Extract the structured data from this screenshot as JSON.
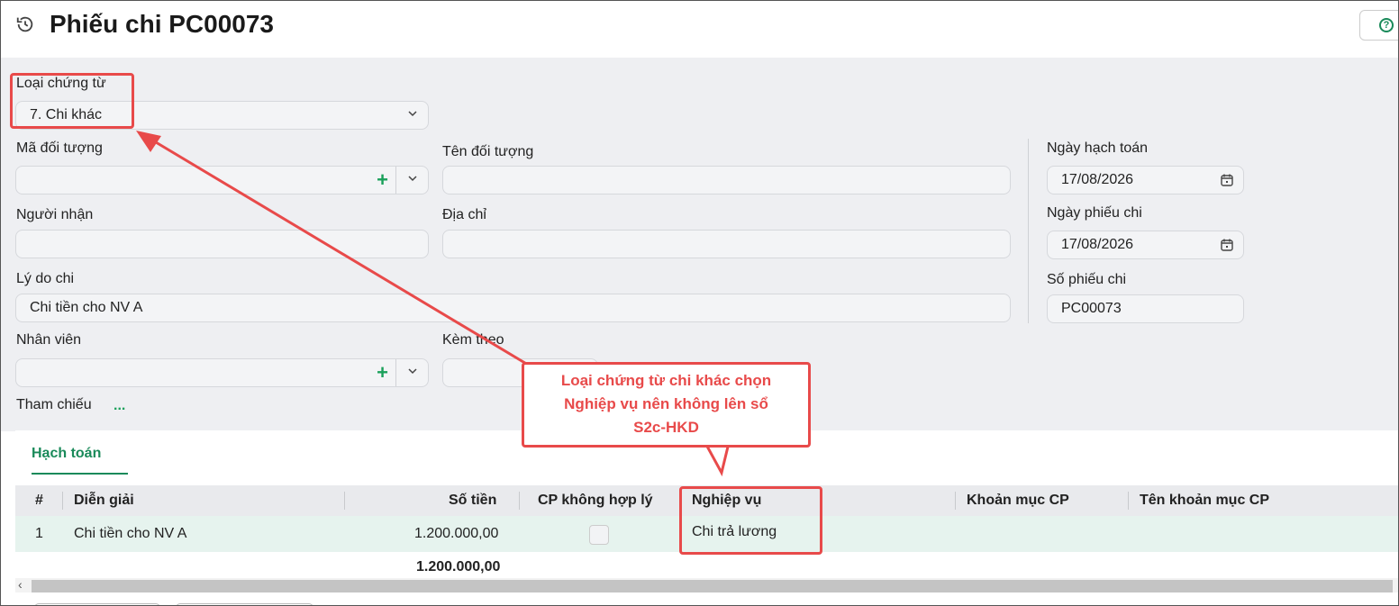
{
  "page": {
    "title": "Phiếu chi PC00073"
  },
  "header": {
    "help_symbol": "?"
  },
  "form": {
    "loai_chung_tu": {
      "label": "Loại chứng từ",
      "value": "7. Chi khác"
    },
    "ma_doi_tuong": {
      "label": "Mã đối tượng",
      "value": ""
    },
    "ten_doi_tuong": {
      "label": "Tên đối tượng",
      "value": ""
    },
    "nguoi_nhan": {
      "label": "Người nhận",
      "value": ""
    },
    "dia_chi": {
      "label": "Địa chỉ",
      "value": ""
    },
    "ly_do_chi": {
      "label": "Lý do chi",
      "value": "Chi tiền cho NV A"
    },
    "nhan_vien": {
      "label": "Nhân viên",
      "value": ""
    },
    "kem_theo": {
      "label": "Kèm theo",
      "value": ""
    },
    "tham_chieu": {
      "label": "Tham chiếu",
      "link": "..."
    },
    "ngay_hach_toan": {
      "label": "Ngày hạch toán",
      "value": "17/08/2026"
    },
    "ngay_phieu_chi": {
      "label": "Ngày phiếu chi",
      "value": "17/08/2026"
    },
    "so_phieu_chi": {
      "label": "Số phiếu chi",
      "value": "PC00073"
    }
  },
  "tabs": [
    {
      "label": "Hạch toán",
      "active": true
    }
  ],
  "table": {
    "columns": [
      "#",
      "Diễn giải",
      "Số tiền",
      "CP không hợp lý",
      "Nghiệp vụ",
      "Khoản mục CP",
      "Tên khoản mục CP"
    ],
    "rows": [
      {
        "index": "1",
        "dien_giai": "Chi tiền cho NV A",
        "so_tien": "1.200.000,00",
        "cp_khong_hop_ly": false,
        "nghiep_vu": "Chi trả lương",
        "khoan_muc_cp": "",
        "ten_khoan_muc_cp": ""
      }
    ],
    "total": "1.200.000,00"
  },
  "annotation": {
    "lines": [
      "Loại chứng từ chi khác chọn",
      "Nghiệp vụ nên không lên sổ",
      "S2c-HKD"
    ],
    "color": "#e84a4a"
  },
  "colors": {
    "accent": "#1a8a5a",
    "highlight": "#e84a4a",
    "row_selected": "#e6f3ee"
  }
}
